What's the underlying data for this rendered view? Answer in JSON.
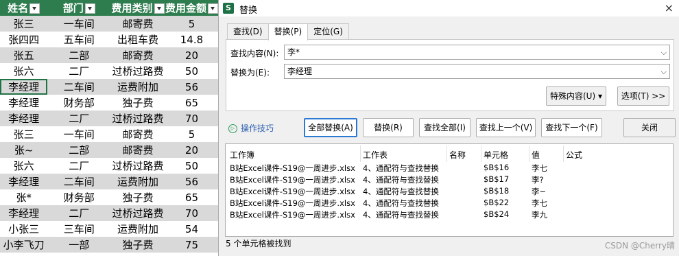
{
  "sheet": {
    "headers": [
      "姓名",
      "部门",
      "费用类别",
      "费用金额"
    ],
    "rows": [
      [
        "张三",
        "一车间",
        "邮寄费",
        "5"
      ],
      [
        "张四四",
        "五车间",
        "出租车费",
        "14.8"
      ],
      [
        "张五",
        "二部",
        "邮寄费",
        "20"
      ],
      [
        "张六",
        "二厂",
        "过桥过路费",
        "50"
      ],
      [
        "李经理",
        "二车间",
        "运费附加",
        "56"
      ],
      [
        "李经理",
        "财务部",
        "独子费",
        "65"
      ],
      [
        "李经理",
        "二厂",
        "过桥过路费",
        "70"
      ],
      [
        "张三",
        "一车间",
        "邮寄费",
        "5"
      ],
      [
        "张~",
        "二部",
        "邮寄费",
        "20"
      ],
      [
        "张六",
        "二厂",
        "过桥过路费",
        "50"
      ],
      [
        "李经理",
        "二车间",
        "运费附加",
        "56"
      ],
      [
        "张*",
        "财务部",
        "独子费",
        "65"
      ],
      [
        "李经理",
        "二厂",
        "过桥过路费",
        "70"
      ],
      [
        "小张三",
        "三车间",
        "运费附加",
        "54"
      ],
      [
        "小李飞刀",
        "一部",
        "独子费",
        "75"
      ]
    ],
    "header_color": "#2e7d4f",
    "band_color": "#d9d9d9"
  },
  "dialog": {
    "app_icon": "S",
    "title": "替换",
    "close": "×",
    "tabs": [
      "查找(D)",
      "替换(P)",
      "定位(G)"
    ],
    "find_label": "查找内容(N):",
    "find_value": "李*",
    "replace_label": "替换为(E):",
    "replace_value": "李经理",
    "dropdown_arrow": "⌵",
    "special_button": "特殊内容(U) ▾",
    "options_button": "选项(T) >>",
    "tips_label": "操作技巧",
    "tips_icon": "▷",
    "buttons": {
      "replace_all": "全部替换(A)",
      "replace": "替换(R)",
      "find_all": "查找全部(I)",
      "find_prev": "查找上一个(V)",
      "find_next": "查找下一个(F)",
      "close": "关闭"
    },
    "accent_color": "#2b79d3"
  },
  "results": {
    "columns": [
      "工作簿",
      "工作表",
      "名称",
      "单元格",
      "值",
      "公式"
    ],
    "rows": [
      [
        "B站Excel课件-S19@一周进步.xlsx",
        "4、通配符与查找替换",
        "",
        "$B$16",
        "李七",
        ""
      ],
      [
        "B站Excel课件-S19@一周进步.xlsx",
        "4、通配符与查找替换",
        "",
        "$B$17",
        "李?",
        ""
      ],
      [
        "B站Excel课件-S19@一周进步.xlsx",
        "4、通配符与查找替换",
        "",
        "$B$18",
        "李~",
        ""
      ],
      [
        "B站Excel课件-S19@一周进步.xlsx",
        "4、通配符与查找替换",
        "",
        "$B$22",
        "李七",
        ""
      ],
      [
        "B站Excel课件-S19@一周进步.xlsx",
        "4、通配符与查找替换",
        "",
        "$B$24",
        "李九",
        ""
      ]
    ],
    "status": "5 个单元格被找到"
  },
  "watermark": "CSDN @Cherry晴"
}
